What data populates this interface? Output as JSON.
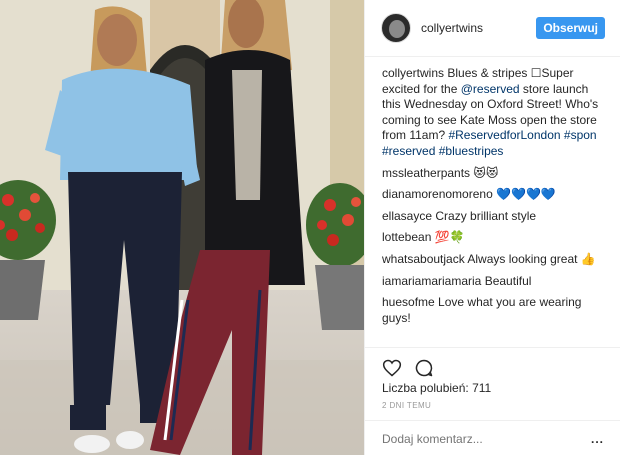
{
  "header": {
    "username": "collyertwins",
    "follow_label": "Obserwuj"
  },
  "caption": {
    "user": "collyertwins",
    "parts": [
      {
        "text": "Blues & stripes ☐Super excited for the ",
        "link": false
      },
      {
        "text": "@reserved",
        "link": true
      },
      {
        "text": " store launch this Wednesday on Oxford Street! Who's coming to see Kate Moss open the store from 11am? ",
        "link": false
      },
      {
        "text": "#ReservedforLondon",
        "link": true
      },
      {
        "text": " ",
        "link": false
      },
      {
        "text": "#spon",
        "link": true
      },
      {
        "text": " ",
        "link": false
      },
      {
        "text": "#reserved",
        "link": true
      },
      {
        "text": " ",
        "link": false
      },
      {
        "text": "#bluestripes",
        "link": true
      }
    ]
  },
  "comments": [
    {
      "user": "mssleatherpants",
      "text": "😻😻"
    },
    {
      "user": "dianamorenomoreno",
      "text": "💙💙💙💙"
    },
    {
      "user": "ellasayce",
      "text": "Crazy brilliant style"
    },
    {
      "user": "lottebean",
      "text": "💯🍀"
    },
    {
      "user": "whatsaboutjack",
      "text": "Always looking great 👍"
    },
    {
      "user": "iamariamariamaria",
      "text": "Beautiful"
    },
    {
      "user": "huesofme",
      "text": "Love what you are wearing guys!"
    }
  ],
  "actions": {
    "like_icon": "heart-icon",
    "comment_icon": "comment-icon"
  },
  "likes": {
    "label": "Liczba polubień:",
    "count": "711"
  },
  "timestamp": "2 DNI TEMU",
  "add_comment": {
    "placeholder": "Dodaj komentarz...",
    "more_label": "..."
  }
}
